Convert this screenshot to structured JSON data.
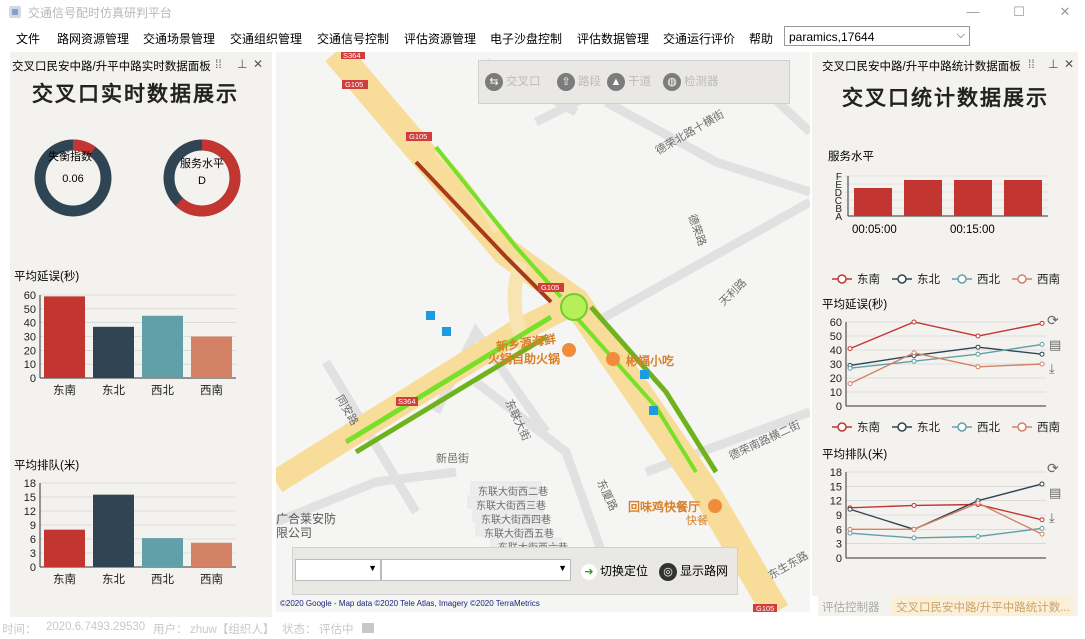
{
  "window": {
    "title": "交通信号配时仿真研判平台",
    "buttons": {
      "minimize": "—",
      "maximize": "☐",
      "close": "✕"
    }
  },
  "menu": {
    "items": [
      "文件",
      "路网资源管理",
      "交通场景管理",
      "交通组织管理",
      "交通信号控制",
      "评估资源管理",
      "电子沙盘控制",
      "评估数据管理",
      "交通运行评价",
      "帮助"
    ],
    "project_select": "paramics,17644"
  },
  "left_panel": {
    "header": "交叉口民安中路/升平中路实时数据面板",
    "title": "交叉口实时数据展示",
    "gauges": [
      {
        "label": "失衡指数",
        "value": "0.06",
        "fraction": 0.1
      },
      {
        "label": "服务水平",
        "value": "D",
        "fraction": 0.62
      }
    ],
    "delay_chart": {
      "type": "bar",
      "ylabel": "平均延误(秒)",
      "categories": [
        "东南",
        "东北",
        "西北",
        "西南"
      ],
      "values": [
        59,
        37,
        45,
        30
      ],
      "colors": [
        "#c23531",
        "#2f4554",
        "#61a0a8",
        "#d48265"
      ],
      "yticks": [
        0,
        10,
        20,
        30,
        40,
        50,
        60
      ],
      "ylim": [
        0,
        60
      ]
    },
    "queue_chart": {
      "type": "bar",
      "ylabel": "平均排队(米)",
      "categories": [
        "东南",
        "东北",
        "西北",
        "西南"
      ],
      "values": [
        8,
        15.5,
        6.2,
        5.2
      ],
      "colors": [
        "#c23531",
        "#2f4554",
        "#61a0a8",
        "#d48265"
      ],
      "yticks": [
        0,
        3,
        6,
        9,
        12,
        15,
        18
      ],
      "ylim": [
        0,
        18
      ]
    }
  },
  "map": {
    "toolbar": [
      "交叉口",
      "路段",
      "干道",
      "检测器"
    ],
    "road_labels": [
      "G105",
      "G105",
      "G105",
      "S364",
      "S364",
      "S364",
      "G105"
    ],
    "street_labels": [
      "德荣北路十横街",
      "德荣路",
      "天利路",
      "同安路",
      "新邑街",
      "东联大街",
      "东联大街西二巷",
      "东联大街西三巷",
      "东联大街西四巷",
      "东联大街西五巷",
      "东联大街西六巷",
      "德荣南路横二街",
      "东厦路",
      "东生东路"
    ],
    "pois": [
      "新乡源海鲜",
      "火锅自助火锅",
      "彬福小吃",
      "回味鸡快餐厅",
      "快餐",
      "广合莱安防",
      "限公司"
    ],
    "attribution": "©2020 Google - Map data ©2020 Tele Atlas, Imagery ©2020 TerraMetrics",
    "controls": {
      "switch_label": "切换定位",
      "network_label": "显示路网"
    }
  },
  "right_panel": {
    "header": "交叉口民安中路/升平中路统计数据面板",
    "title": "交叉口统计数据展示",
    "service_chart": {
      "type": "bar",
      "ylabel": "服务水平",
      "levels": [
        "F",
        "E",
        "D",
        "C",
        "B",
        "A"
      ],
      "xlabels": [
        "00:05:00",
        "00:15:00"
      ],
      "values": [
        3.5,
        4.5,
        4.5,
        4.5
      ],
      "color": "#c23531"
    },
    "legend": [
      "东南",
      "东北",
      "西北",
      "西南"
    ],
    "series_colors": [
      "#c23531",
      "#2f4554",
      "#61a0a8",
      "#d48265"
    ],
    "delay_line": {
      "type": "line",
      "ylabel": "平均延误(秒)",
      "yticks": [
        0,
        10,
        20,
        30,
        40,
        50,
        60
      ],
      "ylim": [
        0,
        60
      ],
      "series": [
        {
          "name": "东南",
          "values": [
            41,
            60,
            50,
            59
          ]
        },
        {
          "name": "东北",
          "values": [
            29,
            36,
            42,
            37
          ]
        },
        {
          "name": "西北",
          "values": [
            27,
            32,
            37,
            44
          ]
        },
        {
          "name": "西南",
          "values": [
            16,
            38,
            28,
            30
          ]
        }
      ]
    },
    "queue_line": {
      "type": "line",
      "ylabel": "平均排队(米)",
      "yticks": [
        0,
        3,
        6,
        9,
        12,
        15,
        18
      ],
      "ylim": [
        0,
        18
      ],
      "series": [
        {
          "name": "东南",
          "values": [
            10.5,
            11,
            11.2,
            8
          ]
        },
        {
          "name": "东北",
          "values": [
            10.2,
            6,
            12,
            15.5
          ]
        },
        {
          "name": "西北",
          "values": [
            5.2,
            4.2,
            4.5,
            6.2
          ]
        },
        {
          "name": "西南",
          "values": [
            6,
            6,
            11.5,
            5
          ]
        }
      ]
    },
    "tabs": [
      "评估控制器",
      "交叉口民安中路/升平中路统计数..."
    ]
  },
  "status": {
    "time_label": "时间：",
    "time": "2020.6.7493.29530",
    "user_label": "用户：",
    "user": "zhuw【组织人】",
    "state_label": "状态：",
    "state": "评估中"
  }
}
